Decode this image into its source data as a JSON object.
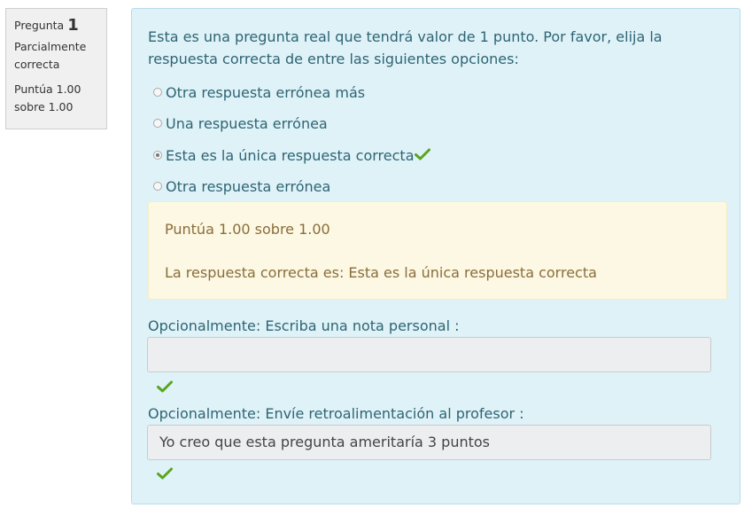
{
  "info": {
    "question_label": "Pregunta",
    "question_number": "1",
    "state": "Parcialmente correcta",
    "grade": "Puntúa 1.00 sobre 1.00"
  },
  "question": {
    "text": "Esta es una pregunta real que tendrá valor de 1 punto. Por favor, elija la respuesta correcta de entre las siguientes opciones:",
    "options": [
      {
        "label": "Otra respuesta errónea más",
        "selected": false
      },
      {
        "label": "Una respuesta errónea",
        "selected": false
      },
      {
        "label": "Esta es la única respuesta correcta",
        "selected": true
      },
      {
        "label": "Otra respuesta errónea",
        "selected": false
      }
    ]
  },
  "feedback": {
    "grade": "Puntúa 1.00 sobre 1.00",
    "right_answer": "La respuesta correcta es: Esta es la única respuesta correcta"
  },
  "personal_note": {
    "label": "Opcionalmente: Escriba una nota personal :",
    "value": ""
  },
  "teacher_feedback": {
    "label": "Opcionalmente: Envíe retroalimentación al profesor :",
    "value": "Yo creo que esta pregunta ameritaría 3 puntos"
  },
  "colors": {
    "check": "#5aa51f",
    "content_bg": "#def2f8",
    "feedback_bg": "#fcf8e3",
    "text_primary": "#2f6473",
    "feedback_text": "#8a6d3b"
  }
}
